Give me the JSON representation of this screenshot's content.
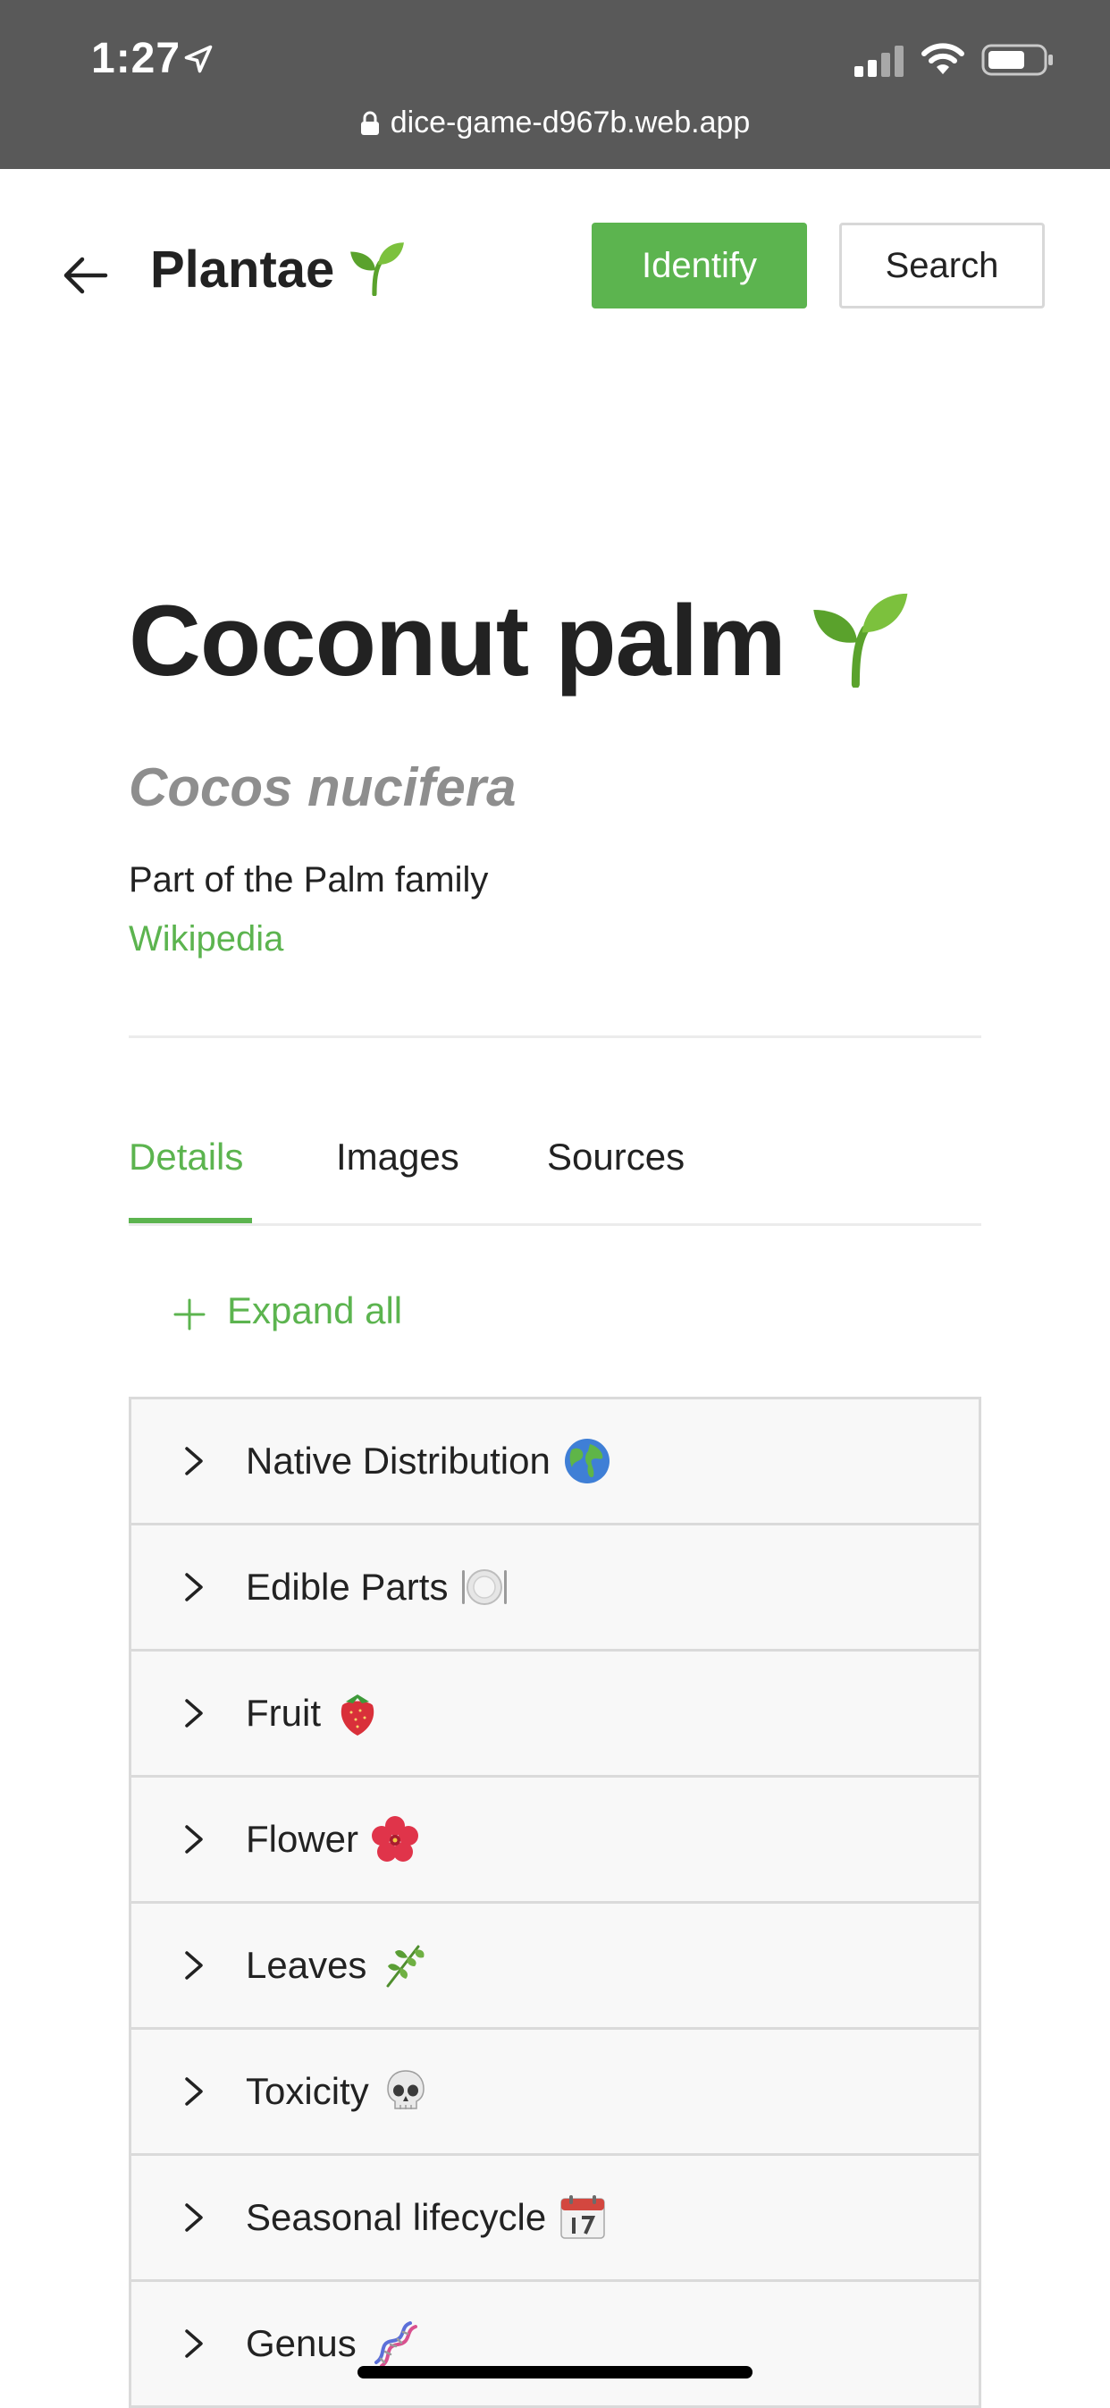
{
  "status_bar": {
    "time": "1:27",
    "url": "dice-game-d967b.web.app"
  },
  "header": {
    "brand": "Plantae",
    "identify_label": "Identify",
    "search_label": "Search"
  },
  "species": {
    "common_name": "Coconut palm",
    "scientific_name": "Cocos nucifera",
    "family_text": "Part of the Palm family",
    "wiki_label": "Wikipedia"
  },
  "tabs": [
    {
      "label": "Details",
      "active": true
    },
    {
      "label": "Images",
      "active": false
    },
    {
      "label": "Sources",
      "active": false
    }
  ],
  "expand_all_label": "Expand all",
  "sections": [
    {
      "label": "Native Distribution",
      "icon": "globe-icon"
    },
    {
      "label": "Edible Parts",
      "icon": "plate-icon"
    },
    {
      "label": "Fruit",
      "icon": "strawberry-icon"
    },
    {
      "label": "Flower",
      "icon": "hibiscus-icon"
    },
    {
      "label": "Leaves",
      "icon": "herb-icon"
    },
    {
      "label": "Toxicity",
      "icon": "skull-icon"
    },
    {
      "label": "Seasonal lifecycle",
      "icon": "calendar-icon"
    },
    {
      "label": "Genus",
      "icon": "dna-icon"
    }
  ],
  "colors": {
    "accent": "#5cb44f",
    "status_bar": "#595959",
    "muted_text": "#8e8e8e",
    "accordion_bg": "#f8f8f8"
  }
}
